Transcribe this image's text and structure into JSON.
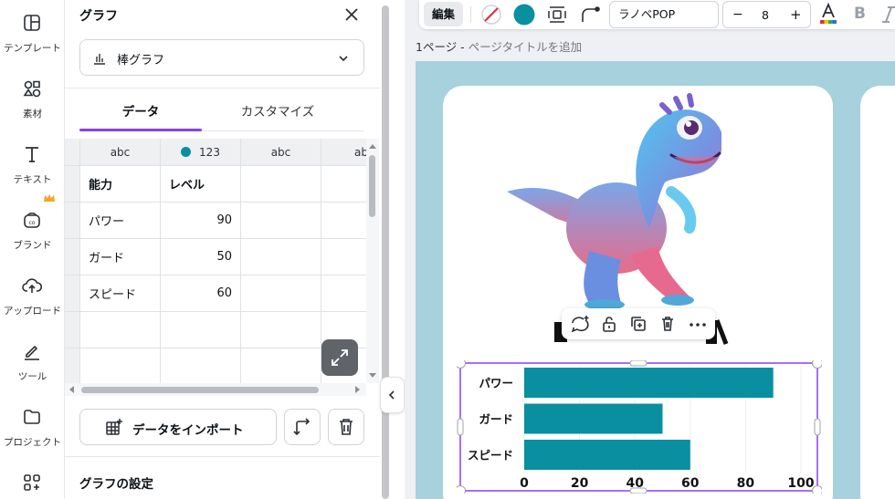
{
  "nav": {
    "items": [
      {
        "label": "テンプレート",
        "icon": "template-icon"
      },
      {
        "label": "素材",
        "icon": "elements-icon"
      },
      {
        "label": "テキスト",
        "icon": "text-icon"
      },
      {
        "label": "ブランド",
        "icon": "brand-icon"
      },
      {
        "label": "アップロード",
        "icon": "upload-icon"
      },
      {
        "label": "ツール",
        "icon": "tools-icon"
      },
      {
        "label": "プロジェクト",
        "icon": "folder-icon"
      },
      {
        "label": "",
        "icon": "apps-icon"
      }
    ]
  },
  "panel": {
    "title": "グラフ",
    "chart_type": "棒グラフ",
    "tabs": [
      "データ",
      "カスタマイズ"
    ],
    "import_label": "データをインポート",
    "settings_title": "グラフの設定"
  },
  "grid": {
    "column_headers": [
      "abc",
      "123",
      "abc",
      "ab"
    ],
    "rows": [
      [
        "能力",
        "レベル",
        "",
        ""
      ],
      [
        "パワー",
        "90",
        "",
        ""
      ],
      [
        "ガード",
        "50",
        "",
        ""
      ],
      [
        "スピード",
        "60",
        "",
        ""
      ],
      [
        "",
        "",
        "",
        ""
      ],
      [
        "",
        "",
        "",
        ""
      ]
    ]
  },
  "toolbar": {
    "edit_label": "編集",
    "font_name": "ラノベPOP",
    "font_size": "8",
    "minus": "−",
    "plus": "+",
    "bold": "B",
    "accent_color": "#0a8fa0"
  },
  "page": {
    "number_label": "1ページ - ",
    "title_placeholder": "ページタイトルを追加"
  },
  "colors": {
    "accent": "#8b3dff",
    "bar": "#0a8fa0",
    "page_bg": "#a7d1dc"
  },
  "chart_data": {
    "type": "bar",
    "orientation": "horizontal",
    "categories": [
      "パワー",
      "ガード",
      "スピード"
    ],
    "values": [
      90,
      50,
      60
    ],
    "xlim": [
      0,
      100
    ],
    "xticks": [
      0,
      20,
      40,
      60,
      80,
      100
    ],
    "grid": true
  }
}
